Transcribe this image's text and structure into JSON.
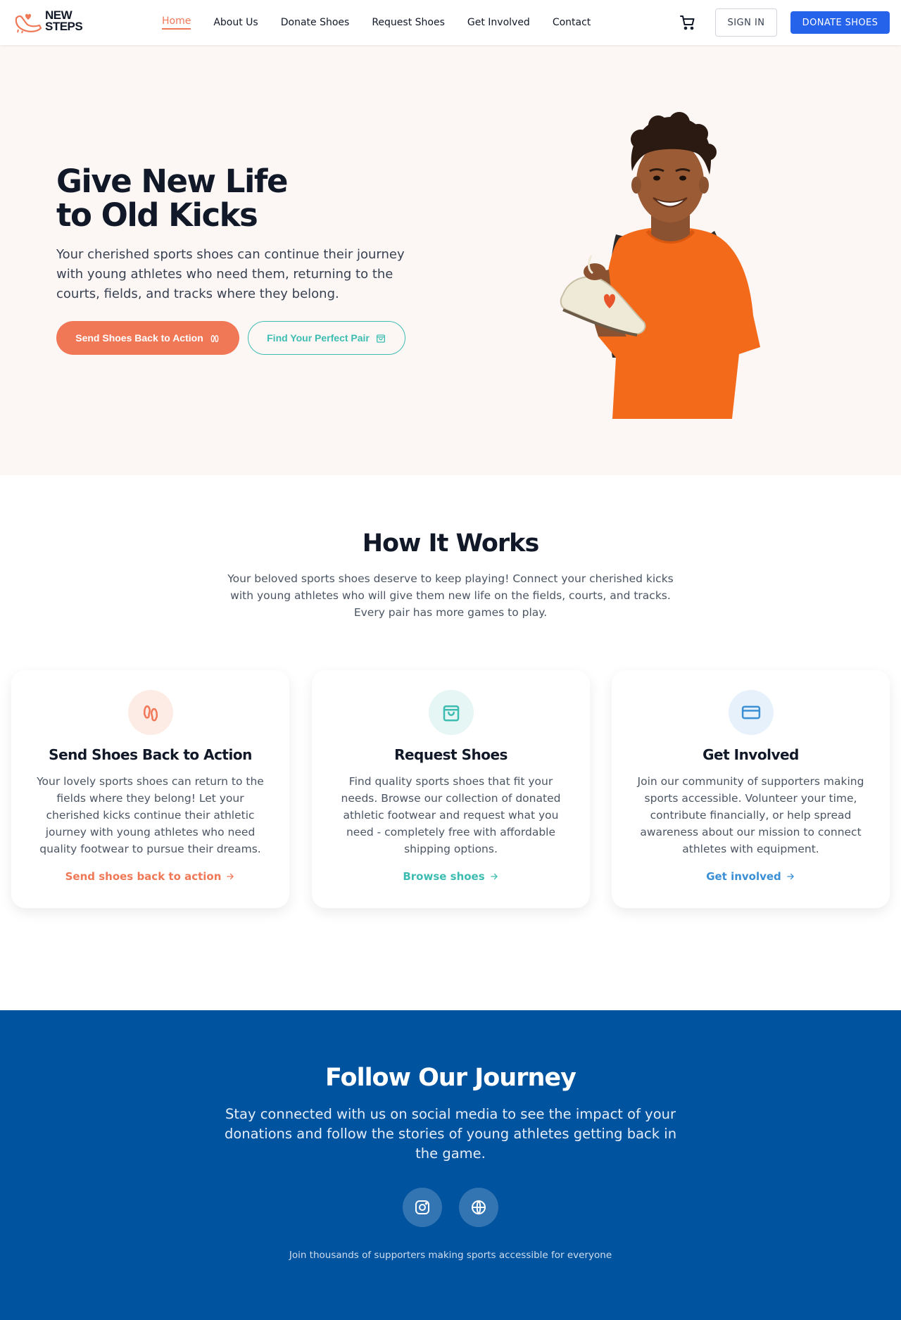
{
  "brand": {
    "logo_line1": "NEW",
    "logo_line2": "STEPS",
    "accent": "#f07857",
    "teal": "#3dbdb1",
    "blue": "#2563eb",
    "navy": "#00539f"
  },
  "nav": {
    "items": [
      {
        "label": "Home",
        "active": true
      },
      {
        "label": "About Us"
      },
      {
        "label": "Donate Shoes"
      },
      {
        "label": "Request Shoes"
      },
      {
        "label": "Get Involved"
      },
      {
        "label": "Contact"
      }
    ],
    "cart_icon": "shopping-cart-icon",
    "signin_label": "SIGN IN",
    "donate_label": "DONATE SHOES"
  },
  "hero": {
    "title_line1": "Give New Life",
    "title_line2": "to Old Kicks",
    "description": "Your cherished sports shoes can continue their journey with young athletes who need them, returning to the courts, fields, and tracks where they belong.",
    "primary_button": "Send Shoes Back to Action",
    "secondary_button": "Find Your Perfect Pair"
  },
  "how": {
    "title": "How It Works",
    "description": "Your beloved sports shoes deserve to keep playing! Connect your cherished kicks with young athletes who will give them new life on the fields, courts, and tracks. Every pair has more games to play.",
    "cards": [
      {
        "icon": "footprints-icon",
        "title": "Send Shoes Back to Action",
        "text": "Your lovely sports shoes can return to the fields where they belong! Let your cherished kicks continue their athletic journey with young athletes who need quality footwear to pursue their dreams.",
        "link": "Send shoes back to action",
        "color": "#f07857"
      },
      {
        "icon": "shopping-bag-icon",
        "title": "Request Shoes",
        "text": "Find quality sports shoes that fit your needs. Browse our collection of donated athletic footwear and request what you need - completely free with affordable shipping options.",
        "link": "Browse shoes",
        "color": "#3dbdb1"
      },
      {
        "icon": "credit-card-icon",
        "title": "Get Involved",
        "text": "Join our community of supporters making sports accessible. Volunteer your time, contribute financially, or help spread awareness about our mission to connect athletes with equipment.",
        "link": "Get involved",
        "color": "#3b8fd4"
      }
    ]
  },
  "follow": {
    "title": "Follow Our Journey",
    "description": "Stay connected with us on social media to see the impact of your donations and follow the stories of young athletes getting back in the game.",
    "social_icons": [
      "instagram-icon",
      "globe-icon"
    ],
    "note": "Join thousands of supporters making sports accessible for everyone"
  }
}
